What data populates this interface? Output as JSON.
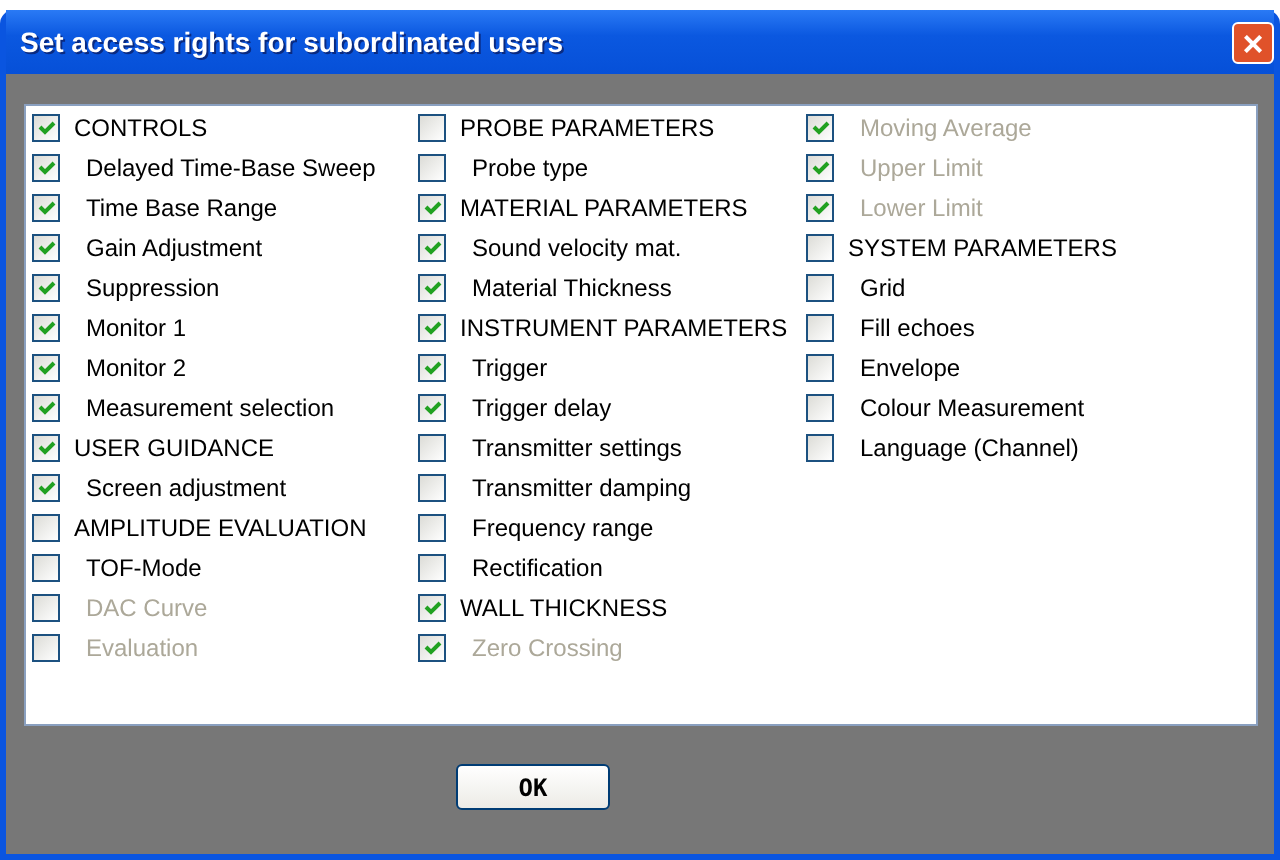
{
  "window": {
    "title": "Set access rights for subordinated users",
    "close": "×"
  },
  "columns": [
    [
      {
        "kind": "group",
        "label": "CONTROLS",
        "checked": true,
        "disabled": false
      },
      {
        "kind": "sub",
        "label": "Delayed Time-Base Sweep",
        "checked": true,
        "disabled": false
      },
      {
        "kind": "sub",
        "label": "Time Base Range",
        "checked": true,
        "disabled": false
      },
      {
        "kind": "sub",
        "label": "Gain Adjustment",
        "checked": true,
        "disabled": false
      },
      {
        "kind": "sub",
        "label": "Suppression",
        "checked": true,
        "disabled": false
      },
      {
        "kind": "sub",
        "label": "Monitor 1",
        "checked": true,
        "disabled": false
      },
      {
        "kind": "sub",
        "label": "Monitor 2",
        "checked": true,
        "disabled": false
      },
      {
        "kind": "sub",
        "label": "Measurement selection",
        "checked": true,
        "disabled": false
      },
      {
        "kind": "group",
        "label": "USER GUIDANCE",
        "checked": true,
        "disabled": false
      },
      {
        "kind": "sub",
        "label": "Screen adjustment",
        "checked": true,
        "disabled": false
      },
      {
        "kind": "group",
        "label": "AMPLITUDE EVALUATION",
        "checked": false,
        "disabled": false
      },
      {
        "kind": "sub",
        "label": "TOF-Mode",
        "checked": false,
        "disabled": false
      },
      {
        "kind": "sub",
        "label": "DAC Curve",
        "checked": false,
        "disabled": true
      },
      {
        "kind": "sub",
        "label": "Evaluation",
        "checked": false,
        "disabled": true
      }
    ],
    [
      {
        "kind": "group",
        "label": "PROBE PARAMETERS",
        "checked": false,
        "disabled": false
      },
      {
        "kind": "sub",
        "label": "Probe type",
        "checked": false,
        "disabled": false
      },
      {
        "kind": "group",
        "label": "MATERIAL PARAMETERS",
        "checked": true,
        "disabled": false
      },
      {
        "kind": "sub",
        "label": "Sound velocity mat.",
        "checked": true,
        "disabled": false
      },
      {
        "kind": "sub",
        "label": "Material Thickness",
        "checked": true,
        "disabled": false
      },
      {
        "kind": "group",
        "label": "INSTRUMENT PARAMETERS",
        "checked": true,
        "disabled": false
      },
      {
        "kind": "sub",
        "label": "Trigger",
        "checked": true,
        "disabled": false
      },
      {
        "kind": "sub",
        "label": "Trigger delay",
        "checked": true,
        "disabled": false
      },
      {
        "kind": "sub",
        "label": "Transmitter settings",
        "checked": false,
        "disabled": false
      },
      {
        "kind": "sub",
        "label": "Transmitter damping",
        "checked": false,
        "disabled": false
      },
      {
        "kind": "sub",
        "label": "Frequency range",
        "checked": false,
        "disabled": false
      },
      {
        "kind": "sub",
        "label": "Rectification",
        "checked": false,
        "disabled": false
      },
      {
        "kind": "group",
        "label": "WALL THICKNESS",
        "checked": true,
        "disabled": false
      },
      {
        "kind": "sub",
        "label": "Zero Crossing",
        "checked": true,
        "disabled": true
      }
    ],
    [
      {
        "kind": "sub",
        "label": "Moving Average",
        "checked": true,
        "disabled": true
      },
      {
        "kind": "sub",
        "label": "Upper Limit",
        "checked": true,
        "disabled": true
      },
      {
        "kind": "sub",
        "label": "Lower Limit",
        "checked": true,
        "disabled": true
      },
      {
        "kind": "group",
        "label": "SYSTEM PARAMETERS",
        "checked": false,
        "disabled": false
      },
      {
        "kind": "sub",
        "label": "Grid",
        "checked": false,
        "disabled": false
      },
      {
        "kind": "sub",
        "label": "Fill echoes",
        "checked": false,
        "disabled": false
      },
      {
        "kind": "sub",
        "label": "Envelope",
        "checked": false,
        "disabled": false
      },
      {
        "kind": "sub",
        "label": "Colour Measurement",
        "checked": false,
        "disabled": false
      },
      {
        "kind": "sub",
        "label": "Language (Channel)",
        "checked": false,
        "disabled": false
      }
    ]
  ],
  "buttons": [
    "OK"
  ]
}
